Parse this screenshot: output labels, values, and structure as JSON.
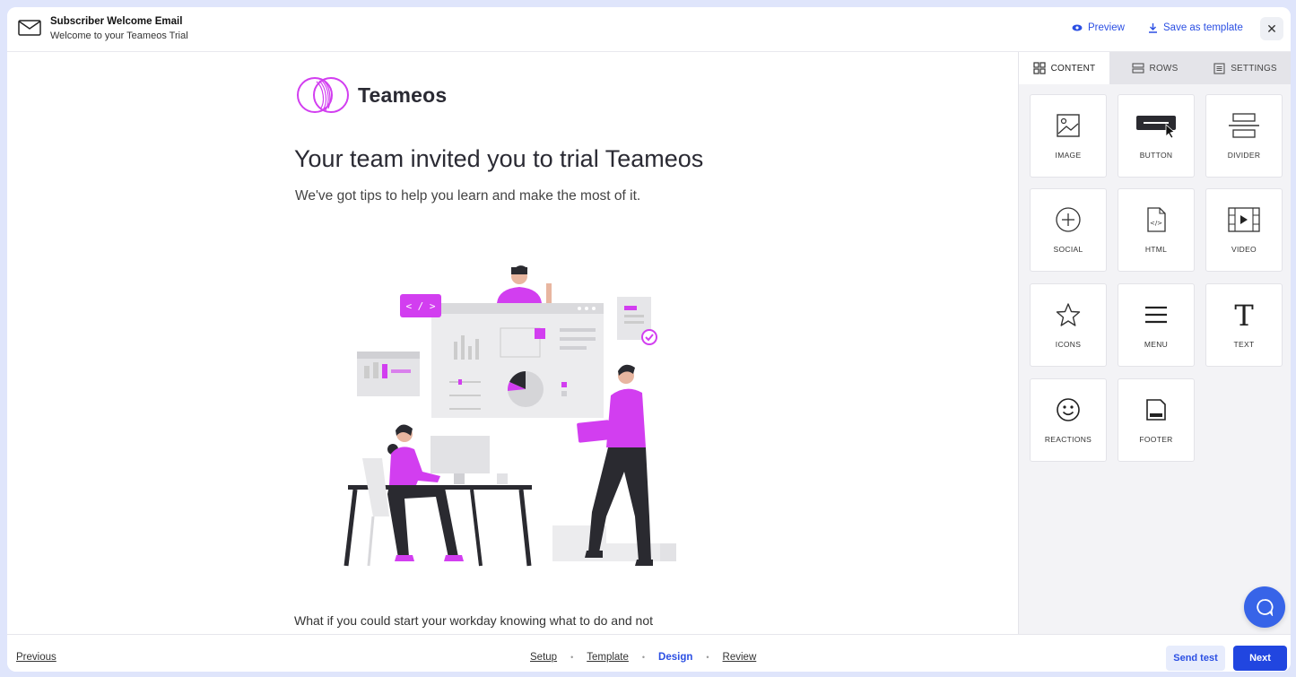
{
  "header": {
    "title": "Subscriber Welcome Email",
    "subtitle": "Welcome to your Teameos Trial",
    "preview_label": "Preview",
    "save_template_label": "Save as template",
    "close_symbol": "✕"
  },
  "email": {
    "brand_name": "Teameos",
    "headline": "Your team invited you to trial Teameos",
    "subheadline": "We've got tips to help you learn and make the most of it.",
    "body_start": "What if you could start your workday knowing what to do and not",
    "illustration_code_tag": "< / >"
  },
  "panel": {
    "tabs": [
      {
        "label": "CONTENT",
        "icon": "grid-icon"
      },
      {
        "label": "ROWS",
        "icon": "rows-icon"
      },
      {
        "label": "SETTINGS",
        "icon": "settings-icon"
      }
    ],
    "active_tab": "CONTENT",
    "tiles": [
      {
        "label": "IMAGE",
        "icon": "image-icon"
      },
      {
        "label": "BUTTON",
        "icon": "button-icon"
      },
      {
        "label": "DIVIDER",
        "icon": "divider-icon"
      },
      {
        "label": "SOCIAL",
        "icon": "social-icon"
      },
      {
        "label": "HTML",
        "icon": "html-icon"
      },
      {
        "label": "VIDEO",
        "icon": "video-icon"
      },
      {
        "label": "ICONS",
        "icon": "star-icon"
      },
      {
        "label": "MENU",
        "icon": "menu-icon"
      },
      {
        "label": "TEXT",
        "icon": "text-icon"
      },
      {
        "label": "REACTIONS",
        "icon": "smiley-icon"
      },
      {
        "label": "FOOTER",
        "icon": "footer-icon"
      }
    ]
  },
  "footer": {
    "previous_label": "Previous",
    "steps": [
      "Setup",
      "Template",
      "Design",
      "Review"
    ],
    "active_step": "Design",
    "send_test_label": "Send test",
    "next_label": "Next"
  },
  "colors": {
    "accent_blue": "#2146e0",
    "brand_magenta": "#d23ef0",
    "background": "#dfe5fb"
  }
}
